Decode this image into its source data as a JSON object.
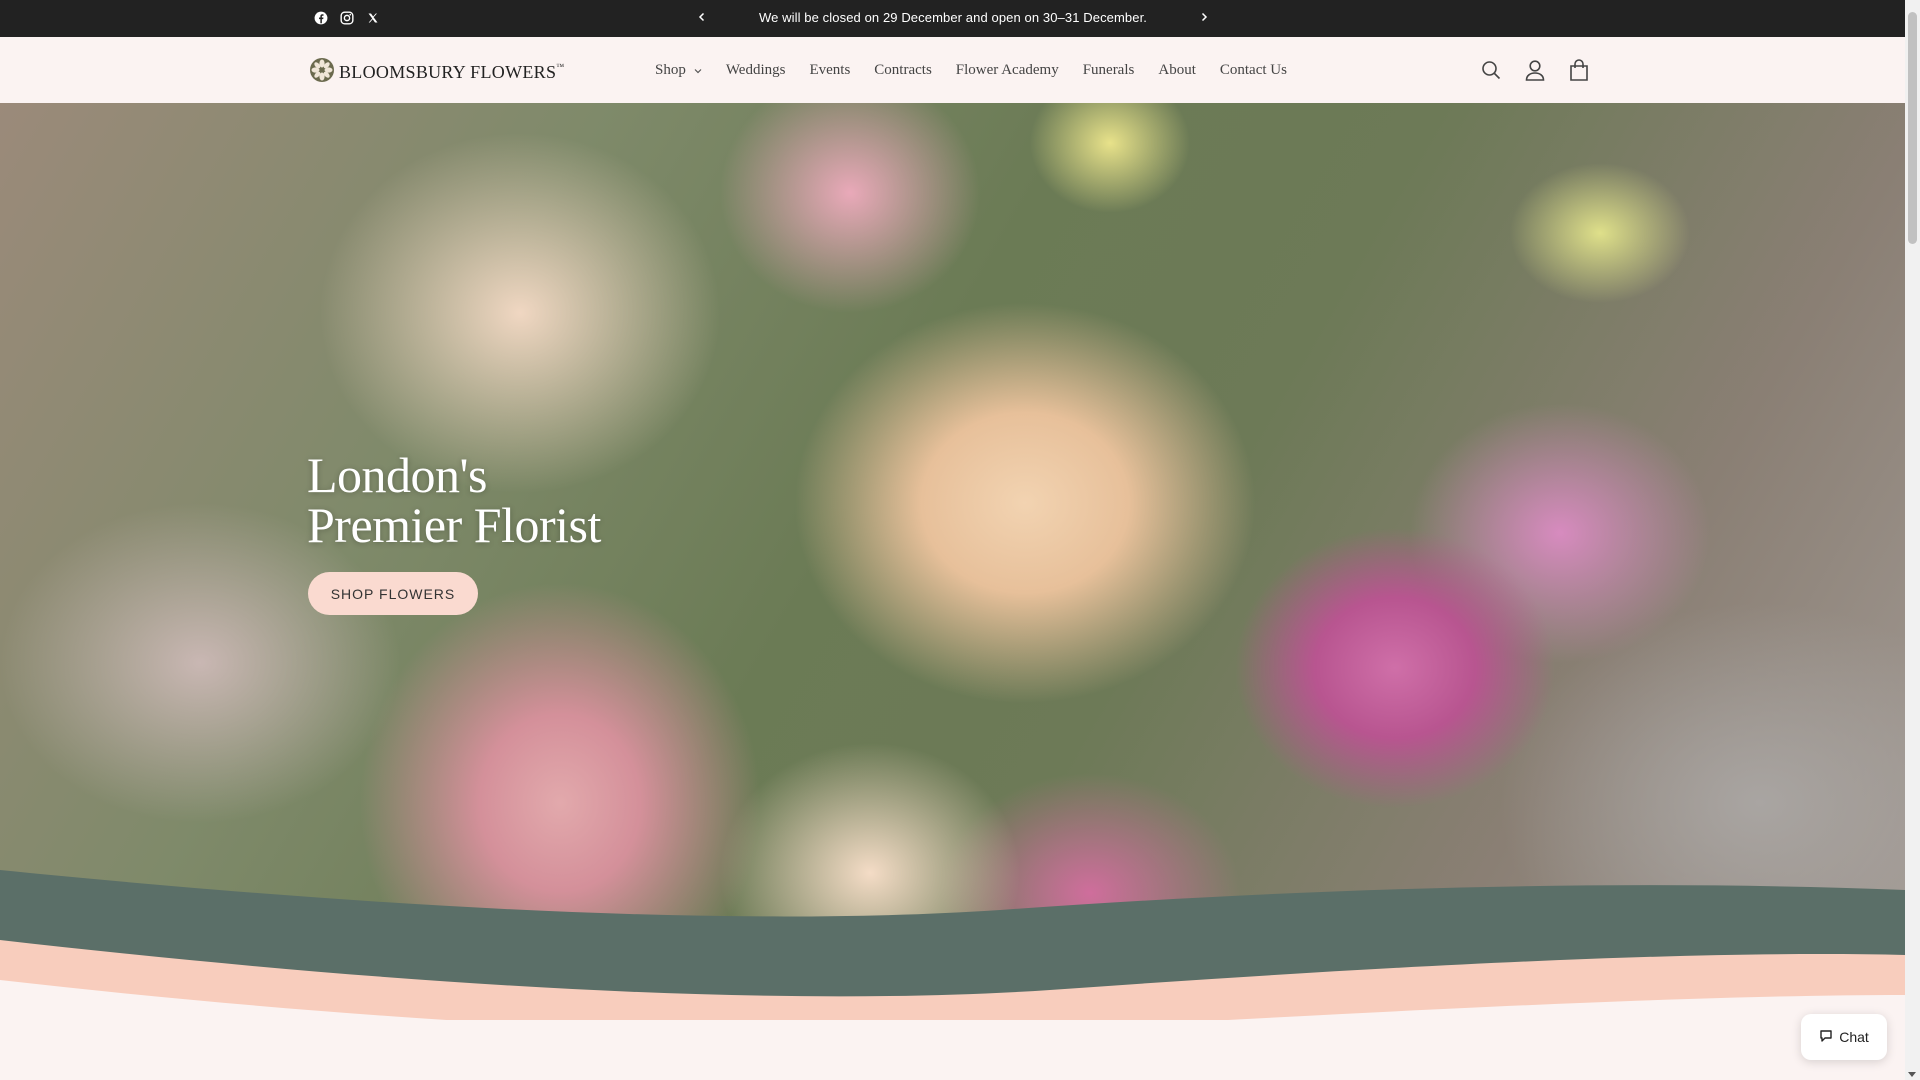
{
  "announcement": {
    "text": "We will be closed on 29 December and open on 30–31 December.",
    "prev_icon": "chevron-left-icon",
    "next_icon": "chevron-right-icon"
  },
  "social": [
    {
      "name": "facebook-icon"
    },
    {
      "name": "instagram-icon"
    },
    {
      "name": "x-icon"
    }
  ],
  "header": {
    "logo_text": "BLOOMSBURY FLOWERS",
    "logo_tm": "™",
    "nav": [
      {
        "label": "Shop",
        "has_dropdown": true
      },
      {
        "label": "Weddings"
      },
      {
        "label": "Events"
      },
      {
        "label": "Contracts"
      },
      {
        "label": "Flower Academy"
      },
      {
        "label": "Funerals"
      },
      {
        "label": "About"
      },
      {
        "label": "Contact Us"
      }
    ],
    "icons": [
      "search-icon",
      "account-icon",
      "cart-icon"
    ]
  },
  "hero": {
    "title_line1": "London's",
    "title_line2": "Premier Florist",
    "cta_label": "SHOP FLOWERS"
  },
  "chat": {
    "label": "Chat"
  },
  "colors": {
    "announcement_bg": "#222222",
    "header_bg": "#fbf3f2",
    "cta_bg": "#fadad0",
    "wave_green": "#5b6f68",
    "wave_peach": "#f8cdbd",
    "page_bg": "#fbf3f2"
  }
}
